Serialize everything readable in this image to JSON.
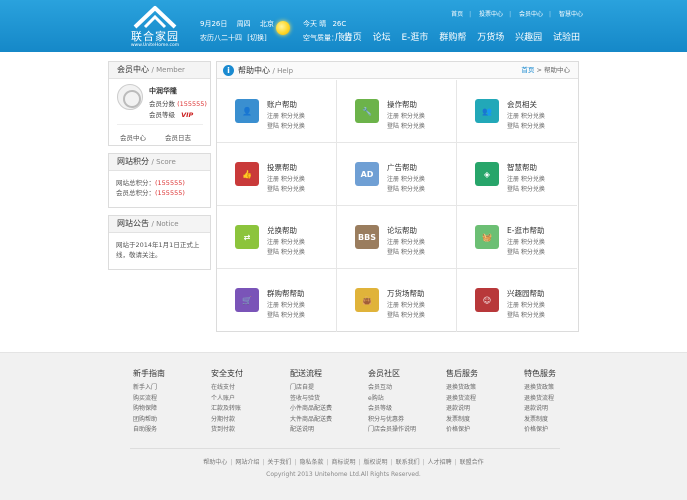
{
  "header": {
    "logo_name": "联合家园",
    "logo_url": "www.UniteHome.com",
    "date": "9月26日",
    "weekday": "周四",
    "city": "北京",
    "lunar": "农历八二十四",
    "switch": "[切换]",
    "weather_today": "今天 晴",
    "temperature": "26C",
    "air_quality": "空气质量：良好",
    "top_links": [
      "首页",
      "投票中心",
      "会员中心",
      "智慧中心"
    ],
    "nav": [
      "广告页",
      "论坛",
      "E-逛市",
      "群购帮",
      "万货场",
      "兴趣园",
      "试验田"
    ]
  },
  "sidebar": {
    "member": {
      "title": "会员中心",
      "title_en": "Member",
      "username": "中润华隆",
      "score_label": "会员分数",
      "score_value": "(155555)",
      "level_label": "会员等级",
      "level_value": "VIP",
      "links": [
        "会员中心",
        "会员日志"
      ]
    },
    "score": {
      "title": "网站积分",
      "title_en": "Score",
      "rows": [
        {
          "label": "网站总积分：",
          "value": "(155555)"
        },
        {
          "label": "会员总积分：",
          "value": "(155555)"
        }
      ]
    },
    "notice": {
      "title": "网站公告",
      "title_en": "Notice",
      "text_line1": "网站于2014年1月1日正式上",
      "text_line2": "线，敬请关注。"
    }
  },
  "main": {
    "title": "帮助中心",
    "title_en": "Help",
    "crumb_home": "首页",
    "crumb_rest": " > 帮助中心",
    "items": [
      {
        "name": "账户帮助",
        "sub1": "注册 积分兑换",
        "sub2": "登陆 积分兑换",
        "icon": "user-icon",
        "color": "#3a8fd0",
        "glyph": "👤"
      },
      {
        "name": "操作帮助",
        "sub1": "注册 积分兑换",
        "sub2": "登陆 积分兑换",
        "icon": "wrench-icon",
        "color": "#6cb34a",
        "glyph": "🔧"
      },
      {
        "name": "会员相关",
        "sub1": "注册 积分兑换",
        "sub2": "登陆 积分兑换",
        "icon": "members-icon",
        "color": "#22a8b8",
        "glyph": "👥"
      },
      {
        "name": "投票帮助",
        "sub1": "注册 积分兑换",
        "sub2": "登陆 积分兑换",
        "icon": "thumbs-up-icon",
        "color": "#c93a3a",
        "glyph": "👍"
      },
      {
        "name": "广告帮助",
        "sub1": "注册 积分兑换",
        "sub2": "登陆 积分兑换",
        "icon": "ad-icon",
        "color": "#6f9fd4",
        "glyph": "AD"
      },
      {
        "name": "智慧帮助",
        "sub1": "注册 积分兑换",
        "sub2": "登陆 积分兑换",
        "icon": "shield-icon",
        "color": "#27a56a",
        "glyph": "◈"
      },
      {
        "name": "兑换帮助",
        "sub1": "注册 积分兑换",
        "sub2": "登陆 积分兑换",
        "icon": "exchange-icon",
        "color": "#8cc43c",
        "glyph": "⇄"
      },
      {
        "name": "论坛帮助",
        "sub1": "注册 积分兑换",
        "sub2": "登陆 积分兑换",
        "icon": "bbs-icon",
        "color": "#9a7d5e",
        "glyph": "BBS"
      },
      {
        "name": "E-逛市帮助",
        "sub1": "注册 积分兑换",
        "sub2": "登陆 积分兑换",
        "icon": "basket-icon",
        "color": "#6cbf74",
        "glyph": "🧺"
      },
      {
        "name": "群购帮帮助",
        "sub1": "注册 积分兑换",
        "sub2": "登陆 积分兑换",
        "icon": "cart-icon",
        "color": "#7a54b8",
        "glyph": "🛒"
      },
      {
        "name": "万货场帮助",
        "sub1": "注册 积分兑换",
        "sub2": "登陆 积分兑换",
        "icon": "bag-icon",
        "color": "#e0b33a",
        "glyph": "👜"
      },
      {
        "name": "兴趣园帮助",
        "sub1": "注册 积分兑换",
        "sub2": "登陆 积分兑换",
        "icon": "smile-icon",
        "color": "#b8383a",
        "glyph": "☺"
      }
    ]
  },
  "footer": {
    "columns": [
      {
        "title": "新手指南",
        "items": [
          "新手入门",
          "购买流程",
          "购物保障",
          "团购帮助",
          "自助服务"
        ]
      },
      {
        "title": "安全支付",
        "items": [
          "在线支付",
          "个人账户",
          "汇款及转账",
          "分期付款",
          "货到付款"
        ]
      },
      {
        "title": "配送流程",
        "items": [
          "门店自提",
          "签收与验货",
          "小件商品配送费",
          "大件商品配送费",
          "配送说明"
        ]
      },
      {
        "title": "会员社区",
        "items": [
          "会员互动",
          "e购站",
          "会员等级",
          "积分与优惠券",
          "门店会员操作说明"
        ]
      },
      {
        "title": "售后服务",
        "items": [
          "退换货政策",
          "退换货流程",
          "退款说明",
          "发票制度",
          "价格保护"
        ]
      },
      {
        "title": "特色服务",
        "items": [
          "退换货政策",
          "退换货流程",
          "退款说明",
          "发票制度",
          "价格保护"
        ]
      }
    ],
    "links": [
      "帮助中心",
      "网站介绍",
      "关于我们",
      "隐私条款",
      "商标说明",
      "版权说明",
      "联系我们",
      "人才招聘",
      "联盟合作"
    ],
    "copyright": "Copyright 2013 Unitehome Ltd.All Rights Reserved."
  }
}
